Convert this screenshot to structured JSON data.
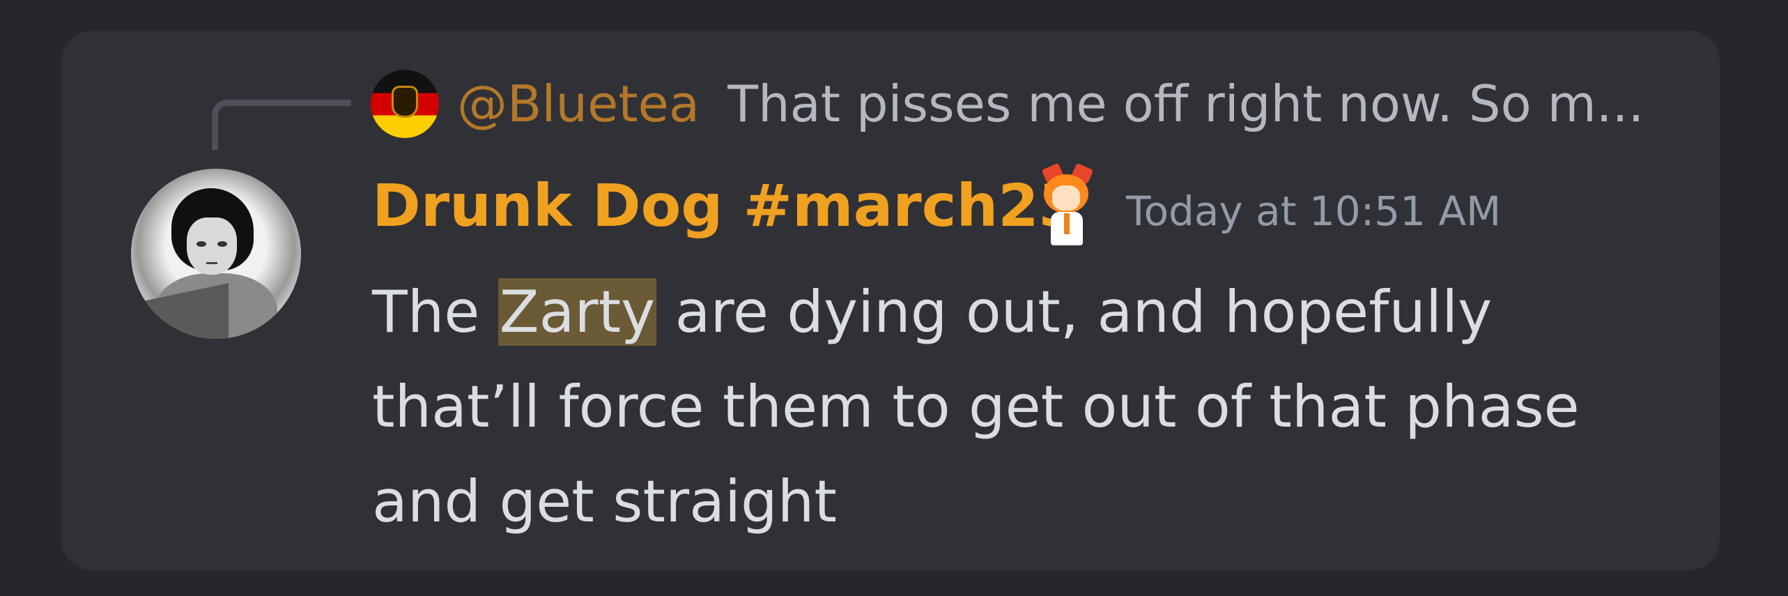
{
  "reply": {
    "author": "@Bluetea",
    "snippet": "That pisses me off right now. So m..."
  },
  "message": {
    "author": "Drunk Dog #march23",
    "timestamp": "Today at 10:51 AM",
    "before_highlight": "The",
    "highlight": "Zarty",
    "after_highlight": "are dying out, and hopefully",
    "line2": "that’ll force them to get out of that phase",
    "line3": "and get straight"
  },
  "colors": {
    "username": "#f0a120",
    "reply_username": "#b3782a",
    "highlight": "#6b5a36"
  },
  "icons": {
    "reply_avatar": "german-flag-avatar",
    "author_avatar": "user-avatar",
    "role_icon": "anime-girl-role-icon"
  }
}
